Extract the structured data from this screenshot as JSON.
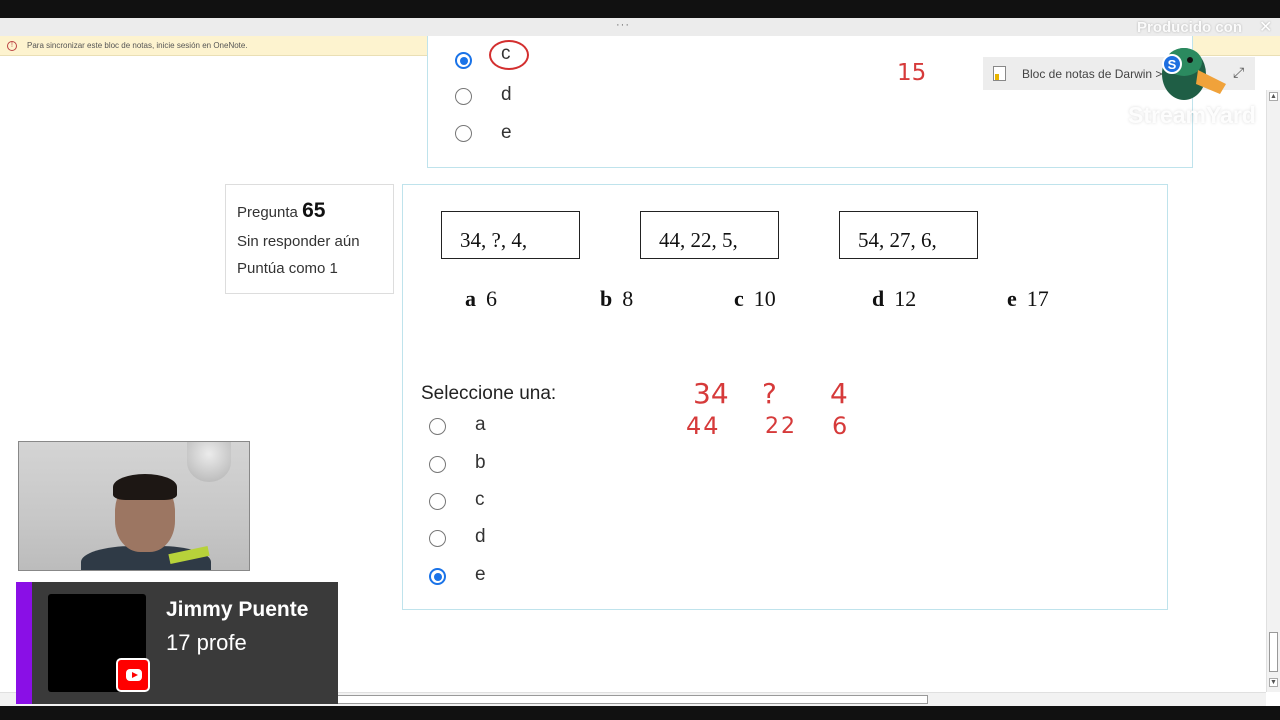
{
  "sync_bar": {
    "text": "Para sincronizar este bloc de notas, inicie sesión en OneNote."
  },
  "titlebar": {
    "dots": "···"
  },
  "previous_question": {
    "options": [
      {
        "label": "c",
        "selected": true
      },
      {
        "label": "d",
        "selected": false
      },
      {
        "label": "e",
        "selected": false
      }
    ],
    "handwritten": "15"
  },
  "question_info": {
    "pregunta_label": "Pregunta",
    "number": "65",
    "status": "Sin responder aún",
    "score": "Puntúa como 1"
  },
  "question": {
    "sequences": [
      "34,  ?,  4,",
      "44,  22,  5,",
      "54,  27,  6,"
    ],
    "answers": [
      {
        "letter": "a",
        "value": "6"
      },
      {
        "letter": "b",
        "value": "8"
      },
      {
        "letter": "c",
        "value": "10"
      },
      {
        "letter": "d",
        "value": "12"
      },
      {
        "letter": "e",
        "value": "17"
      }
    ],
    "select_prompt": "Seleccione una:",
    "options": [
      {
        "label": "a",
        "selected": false
      },
      {
        "label": "b",
        "selected": false
      },
      {
        "label": "c",
        "selected": false
      },
      {
        "label": "d",
        "selected": false
      },
      {
        "label": "e",
        "selected": true
      }
    ]
  },
  "handwriting": {
    "row1": [
      "34",
      "?",
      "4"
    ],
    "row2": [
      "44",
      "22",
      "6"
    ]
  },
  "notebook": {
    "label": "Bloc de notas de Darwin >",
    "expand_icon": "expand-icon"
  },
  "overlay": {
    "produced_by": "Producido con",
    "close": "✕",
    "brand": "StreamYard",
    "duck_letter": "S"
  },
  "youtube_card": {
    "name": "Jimmy Puente",
    "subtitle": "17 profe"
  },
  "colors": {
    "accent_blue": "#1a73e8",
    "handwriting_red": "#d63a3a",
    "card_border": "#bfe3ec",
    "banner_purple": "#8a0fe6",
    "youtube_red": "#ff0000"
  }
}
